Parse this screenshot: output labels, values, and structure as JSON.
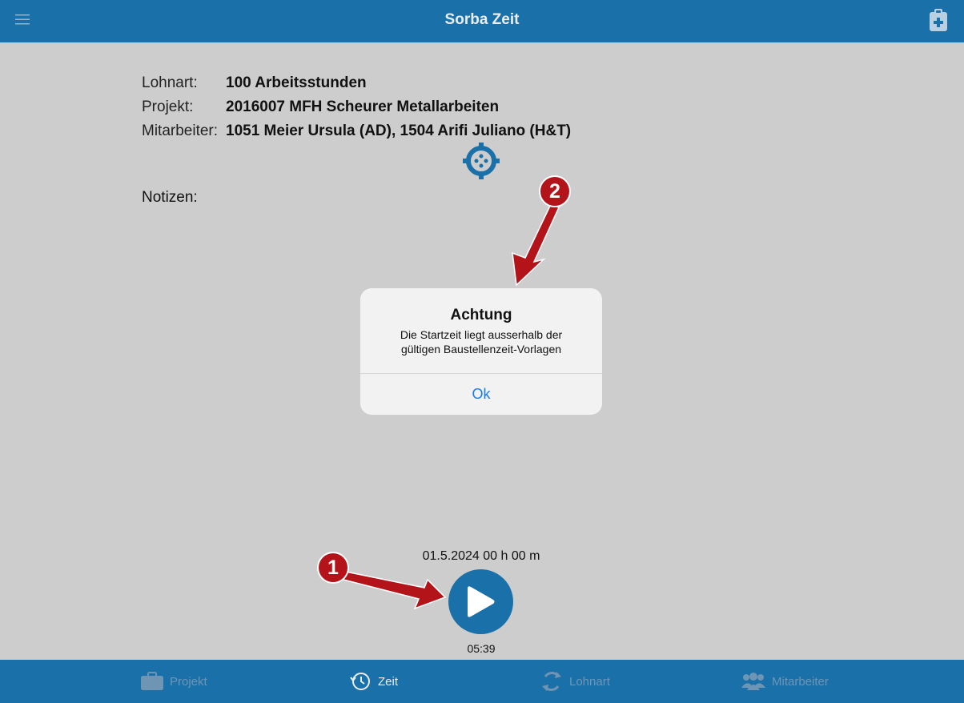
{
  "header": {
    "title": "Sorba Zeit",
    "menu_icon": "hamburger-menu-icon",
    "action_icon": "clipboard-plus-icon"
  },
  "details": {
    "rows": [
      {
        "label": "Lohnart:",
        "value": "100 Arbeitsstunden"
      },
      {
        "label": "Projekt:",
        "value": "2016007 MFH Scheurer Metallarbeiten"
      },
      {
        "label": "Mitarbeiter:",
        "value": "1051 Meier Ursula (AD), 1504 Arifi Juliano (H&T)"
      }
    ],
    "location_icon": "crosshair-target-icon",
    "notes_label": "Notizen:"
  },
  "dialog": {
    "title": "Achtung",
    "message": "Die Startzeit liegt ausserhalb der gültigen Baustellenzeit-Vorlagen",
    "ok_label": "Ok"
  },
  "timer": {
    "date_duration": "01.5.2024 00 h 00 m",
    "elapsed": "05:39",
    "play_icon": "play-icon"
  },
  "annotations": {
    "badge_1": "1",
    "badge_2": "2"
  },
  "tabs": [
    {
      "label": "Projekt",
      "icon": "briefcase-icon",
      "active": false
    },
    {
      "label": "Zeit",
      "icon": "clock-icon",
      "active": true
    },
    {
      "label": "Lohnart",
      "icon": "refresh-icon",
      "active": false
    },
    {
      "label": "Mitarbeiter",
      "icon": "users-icon",
      "active": false
    }
  ],
  "colors": {
    "bar": "#1a70a8",
    "background": "#cdcdcd",
    "annotation_red": "#b3141a",
    "link_blue": "#1a7de0"
  }
}
